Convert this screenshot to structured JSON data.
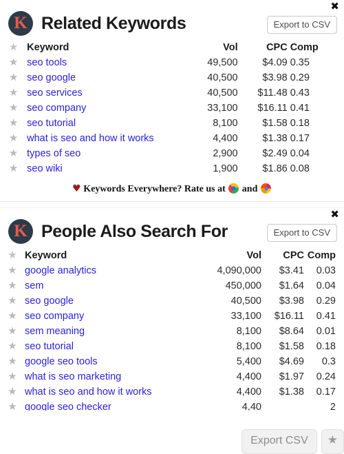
{
  "panels": [
    {
      "id": "related-keywords",
      "logo_letter": "K",
      "title": "Related Keywords",
      "export_label": "Export to CSV",
      "close_icon": "✖",
      "star_icon": "★",
      "columns": {
        "keyword": "Keyword",
        "vol": "Vol",
        "cpc": "CPC",
        "comp": "Comp"
      },
      "rows": [
        {
          "keyword": "seo tools",
          "vol": "49,500",
          "cpc": "$4.09",
          "comp": "0.35"
        },
        {
          "keyword": "seo google",
          "vol": "40,500",
          "cpc": "$3.98",
          "comp": "0.29"
        },
        {
          "keyword": "seo services",
          "vol": "40,500",
          "cpc": "$11.48",
          "comp": "0.43"
        },
        {
          "keyword": "seo company",
          "vol": "33,100",
          "cpc": "$16.11",
          "comp": "0.41"
        },
        {
          "keyword": "seo tutorial",
          "vol": "8,100",
          "cpc": "$1.58",
          "comp": "0.18"
        },
        {
          "keyword": "what is seo and how it works",
          "vol": "4,400",
          "cpc": "$1.38",
          "comp": "0.17"
        },
        {
          "keyword": "types of seo",
          "vol": "2,900",
          "cpc": "$2.49",
          "comp": "0.04"
        },
        {
          "keyword": "seo wiki",
          "vol": "1,900",
          "cpc": "$1.86",
          "comp": "0.08"
        }
      ],
      "footer": {
        "heart_icon": "♥",
        "text_before": "Keywords Everywhere? Rate us at",
        "chrome_icon": "chrome-icon",
        "text_between": "and",
        "firefox_icon": "firefox-icon"
      }
    },
    {
      "id": "people-also-search-for",
      "logo_letter": "K",
      "title": "People Also Search For",
      "export_label": "Export to CSV",
      "close_icon": "✖",
      "star_icon": "★",
      "columns": {
        "keyword": "Keyword",
        "vol": "Vol",
        "cpc": "CPC",
        "comp": "Comp"
      },
      "rows": [
        {
          "keyword": "google analytics",
          "vol": "4,090,000",
          "cpc": "$3.41",
          "comp": "0.03"
        },
        {
          "keyword": "sem",
          "vol": "450,000",
          "cpc": "$1.64",
          "comp": "0.04"
        },
        {
          "keyword": "seo google",
          "vol": "40,500",
          "cpc": "$3.98",
          "comp": "0.29"
        },
        {
          "keyword": "seo company",
          "vol": "33,100",
          "cpc": "$16.11",
          "comp": "0.41"
        },
        {
          "keyword": "sem meaning",
          "vol": "8,100",
          "cpc": "$8.64",
          "comp": "0.01"
        },
        {
          "keyword": "seo tutorial",
          "vol": "8,100",
          "cpc": "$1.58",
          "comp": "0.18"
        },
        {
          "keyword": "google seo tools",
          "vol": "5,400",
          "cpc": "$4.69",
          "comp": "0.3"
        },
        {
          "keyword": "what is seo marketing",
          "vol": "4,400",
          "cpc": "$1.97",
          "comp": "0.24"
        },
        {
          "keyword": "what is seo and how it works",
          "vol": "4,400",
          "cpc": "$1.38",
          "comp": "0.17"
        },
        {
          "keyword": "google seo checker",
          "vol": "4,40",
          "cpc": "",
          "comp": "2"
        }
      ]
    }
  ],
  "floating_bar": {
    "export_label": "Export CSV",
    "star_icon": "★"
  }
}
